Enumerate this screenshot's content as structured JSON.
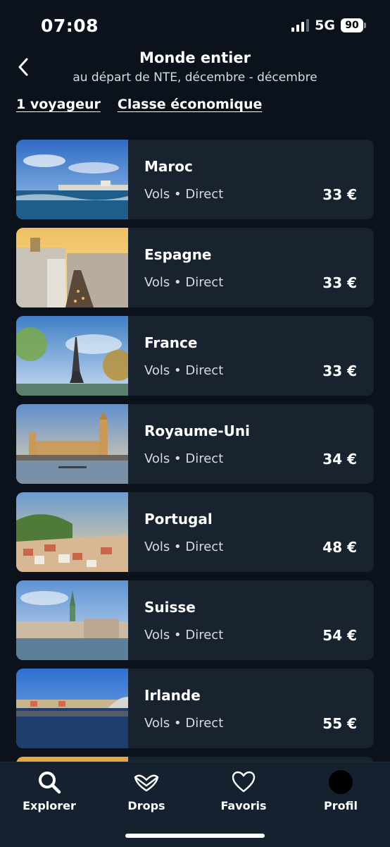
{
  "status_bar": {
    "time": "07:08",
    "network": "5G",
    "battery": "90"
  },
  "header": {
    "title": "Monde entier",
    "subtitle": "au départ de NTE, décembre - décembre",
    "travellers": "1 voyageur",
    "cabin_class": "Classe économique"
  },
  "destinations": [
    {
      "name": "Maroc",
      "meta": "Vols • Direct",
      "price": "33 €"
    },
    {
      "name": "Espagne",
      "meta": "Vols • Direct",
      "price": "33 €"
    },
    {
      "name": "France",
      "meta": "Vols • Direct",
      "price": "33 €"
    },
    {
      "name": "Royaume-Uni",
      "meta": "Vols • Direct",
      "price": "34 €"
    },
    {
      "name": "Portugal",
      "meta": "Vols • Direct",
      "price": "48 €"
    },
    {
      "name": "Suisse",
      "meta": "Vols • Direct",
      "price": "54 €"
    },
    {
      "name": "Irlande",
      "meta": "Vols • Direct",
      "price": "55 €"
    }
  ],
  "bottom_nav": [
    {
      "label": "Explorer",
      "icon": "search-icon"
    },
    {
      "label": "Drops",
      "icon": "drops-icon"
    },
    {
      "label": "Favoris",
      "icon": "heart-icon"
    },
    {
      "label": "Profil",
      "icon": "avatar"
    }
  ],
  "colors": {
    "background": "#0b121c",
    "card": "#19222f",
    "nav": "#162130",
    "text": "#ffffff"
  }
}
